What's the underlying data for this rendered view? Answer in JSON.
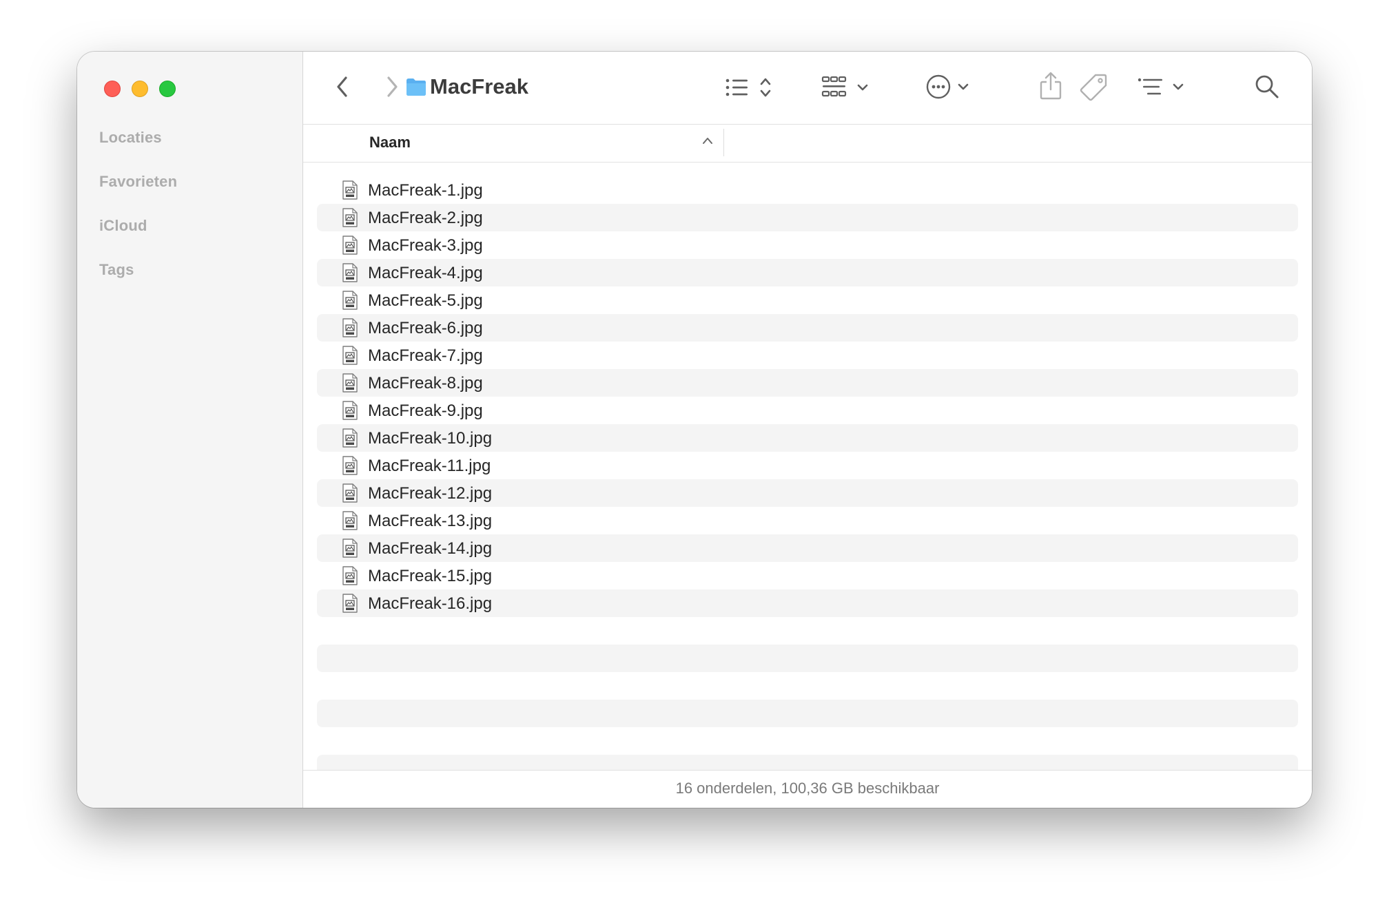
{
  "window": {
    "title": "MacFreak",
    "controls": [
      "close",
      "minimize",
      "zoom"
    ]
  },
  "sidebar": {
    "sections": [
      {
        "label": "Locaties"
      },
      {
        "label": "Favorieten"
      },
      {
        "label": "iCloud"
      },
      {
        "label": "Tags"
      }
    ]
  },
  "toolbar": {
    "icons": [
      "chevron-left-icon",
      "chevron-right-icon",
      "folder-icon",
      "list-view-icon",
      "group-icon",
      "more-actions-icon",
      "share-icon",
      "tag-icon",
      "sort-options-icon",
      "search-icon"
    ]
  },
  "columns": {
    "name_label": "Naam",
    "sort": "ascending"
  },
  "files": [
    "MacFreak-1.jpg",
    "MacFreak-2.jpg",
    "MacFreak-3.jpg",
    "MacFreak-4.jpg",
    "MacFreak-5.jpg",
    "MacFreak-6.jpg",
    "MacFreak-7.jpg",
    "MacFreak-8.jpg",
    "MacFreak-9.jpg",
    "MacFreak-10.jpg",
    "MacFreak-11.jpg",
    "MacFreak-12.jpg",
    "MacFreak-13.jpg",
    "MacFreak-14.jpg",
    "MacFreak-15.jpg",
    "MacFreak-16.jpg"
  ],
  "status": {
    "text": "16 onderdelen, 100,36 GB beschikbaar"
  },
  "colors": {
    "close": "#fe5f57",
    "minimize": "#febc2e",
    "zoom": "#28c840",
    "folder": "#5ab0f0",
    "row_alt": "#f4f4f4",
    "sidebar": "#f5f5f5"
  }
}
